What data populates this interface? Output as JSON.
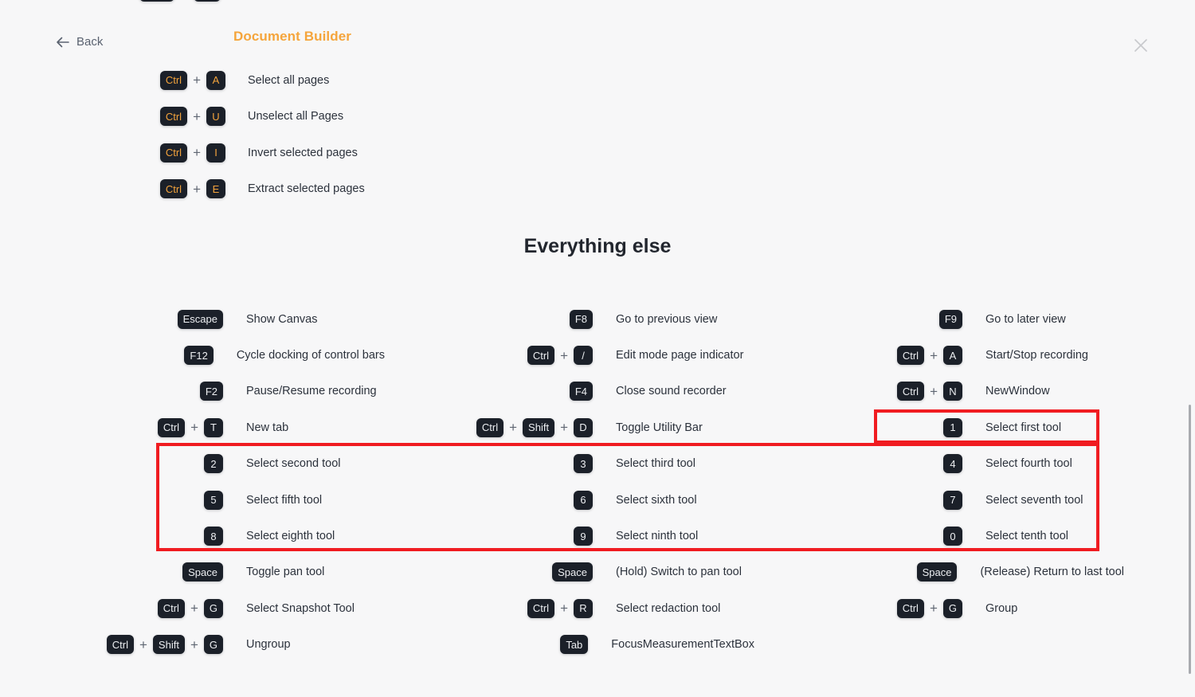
{
  "header": {
    "back_label": "Back",
    "section_title": "Document Builder",
    "close_icon": "close-icon",
    "back_icon": "arrow-left-icon"
  },
  "colors": {
    "background": "#f7f7f8",
    "accent_orange": "#f5a53c",
    "keycap_bg": "#1b2029",
    "keycap_text": "#eceef1",
    "highlight_red": "#f01c21",
    "description_text": "#2c323c"
  },
  "cut_off_row": {
    "keys": [
      "",
      "",
      ""
    ],
    "description": ""
  },
  "document_builder": {
    "rows": [
      {
        "keys": [
          "Ctrl",
          "A"
        ],
        "description": "Select all pages"
      },
      {
        "keys": [
          "Ctrl",
          "U"
        ],
        "description": "Unselect all Pages"
      },
      {
        "keys": [
          "Ctrl",
          "I"
        ],
        "description": "Invert selected pages"
      },
      {
        "keys": [
          "Ctrl",
          "E"
        ],
        "description": "Extract selected pages"
      }
    ]
  },
  "everything_else": {
    "title": "Everything else",
    "rows": [
      [
        {
          "keys": [
            "Escape"
          ],
          "description": "Show Canvas"
        },
        {
          "keys": [
            "F8"
          ],
          "description": "Go to previous view"
        },
        {
          "keys": [
            "F9"
          ],
          "description": "Go to later view"
        }
      ],
      [
        {
          "keys": [
            "F12"
          ],
          "description": "Cycle docking of control bars"
        },
        {
          "keys": [
            "Ctrl",
            "/"
          ],
          "description": "Edit mode page indicator"
        },
        {
          "keys": [
            "Ctrl",
            "A"
          ],
          "description": "Start/Stop recording"
        }
      ],
      [
        {
          "keys": [
            "F2"
          ],
          "description": "Pause/Resume recording"
        },
        {
          "keys": [
            "F4"
          ],
          "description": "Close sound recorder"
        },
        {
          "keys": [
            "Ctrl",
            "N"
          ],
          "description": "NewWindow"
        }
      ],
      [
        {
          "keys": [
            "Ctrl",
            "T"
          ],
          "description": "New tab"
        },
        {
          "keys": [
            "Ctrl",
            "Shift",
            "D"
          ],
          "description": "Toggle Utility Bar"
        },
        {
          "keys": [
            "1"
          ],
          "description": "Select first tool"
        }
      ],
      [
        {
          "keys": [
            "2"
          ],
          "description": "Select second tool"
        },
        {
          "keys": [
            "3"
          ],
          "description": "Select third tool"
        },
        {
          "keys": [
            "4"
          ],
          "description": "Select fourth tool"
        }
      ],
      [
        {
          "keys": [
            "5"
          ],
          "description": "Select fifth tool"
        },
        {
          "keys": [
            "6"
          ],
          "description": "Select sixth tool"
        },
        {
          "keys": [
            "7"
          ],
          "description": "Select seventh tool"
        }
      ],
      [
        {
          "keys": [
            "8"
          ],
          "description": "Select eighth tool"
        },
        {
          "keys": [
            "9"
          ],
          "description": "Select ninth tool"
        },
        {
          "keys": [
            "0"
          ],
          "description": "Select tenth tool"
        }
      ],
      [
        {
          "keys": [
            "Space"
          ],
          "description": "Toggle pan tool"
        },
        {
          "keys": [
            "Space"
          ],
          "description": "(Hold) Switch to pan tool"
        },
        {
          "keys": [
            "Space"
          ],
          "description": "(Release) Return to last tool"
        }
      ],
      [
        {
          "keys": [
            "Ctrl",
            "G"
          ],
          "description": "Select Snapshot Tool"
        },
        {
          "keys": [
            "Ctrl",
            "R"
          ],
          "description": "Select redaction tool"
        },
        {
          "keys": [
            "Ctrl",
            "G"
          ],
          "description": "Group"
        }
      ],
      [
        {
          "keys": [
            "Ctrl",
            "Shift",
            "G"
          ],
          "description": "Ungroup"
        },
        {
          "keys": [
            "Tab"
          ],
          "description": "FocusMeasurementTextBox"
        },
        {
          "keys": [],
          "description": ""
        }
      ]
    ]
  },
  "highlights": [
    {
      "name": "select-first-tool-highlight",
      "target": "Select first tool"
    },
    {
      "name": "tool-selection-block-highlight",
      "target": "Select second tool through Select tenth tool"
    }
  ],
  "scrollbar": {
    "orientation": "vertical"
  }
}
